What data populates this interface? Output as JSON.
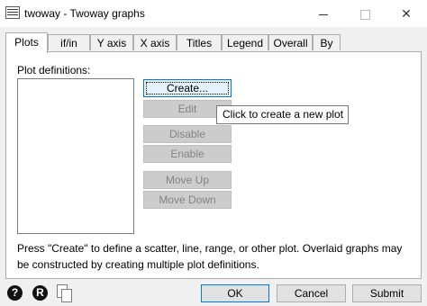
{
  "window": {
    "title": "twoway - Twoway graphs"
  },
  "tabs": [
    {
      "label": "Plots"
    },
    {
      "label": "if/in"
    },
    {
      "label": "Y axis"
    },
    {
      "label": "X axis"
    },
    {
      "label": "Titles"
    },
    {
      "label": "Legend"
    },
    {
      "label": "Overall"
    },
    {
      "label": "By"
    }
  ],
  "plots": {
    "definitions_label": "Plot definitions:",
    "buttons": {
      "create": "Create...",
      "edit": "Edit",
      "disable": "Disable",
      "enable": "Enable",
      "move_up": "Move Up",
      "move_down": "Move Down"
    },
    "tooltip": "Click to create a new plot",
    "note": "Press \"Create\" to define a scatter, line, range, or other plot. Overlaid graphs may be constructed by creating multiple plot definitions."
  },
  "footer": {
    "help_icon_glyph": "?",
    "record_icon_glyph": "R",
    "ok": "OK",
    "cancel": "Cancel",
    "submit": "Submit"
  },
  "icons": {
    "app": "window-icon",
    "help": "help-icon",
    "record": "record-icon",
    "copy": "copy-icon"
  }
}
